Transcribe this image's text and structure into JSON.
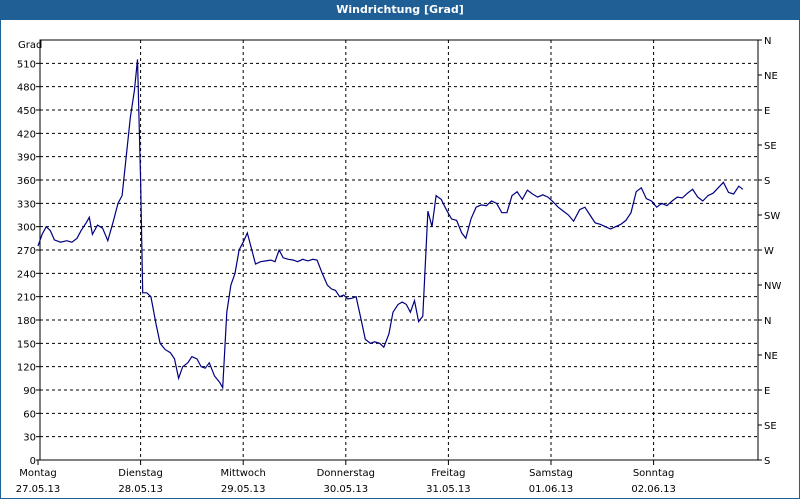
{
  "window": {
    "title": "Windrichtung [Grad]"
  },
  "chart_data": {
    "type": "line",
    "title": "Windrichtung [Grad]",
    "ylabel": "Grad",
    "ylim": [
      0,
      540
    ],
    "yticks": [
      0,
      30,
      60,
      90,
      120,
      150,
      180,
      210,
      240,
      270,
      300,
      330,
      360,
      390,
      420,
      450,
      480,
      510
    ],
    "y2_ticks": [
      "S",
      "SE",
      "E",
      "NE",
      "N",
      "NW",
      "W",
      "SW",
      "S",
      "SE",
      "E",
      "NE",
      "N"
    ],
    "grid": true,
    "x_labels": [
      {
        "day": "Montag",
        "date": "27.05.13"
      },
      {
        "day": "Dienstag",
        "date": "28.05.13"
      },
      {
        "day": "Mittwoch",
        "date": "29.05.13"
      },
      {
        "day": "Donnerstag",
        "date": "30.05.13"
      },
      {
        "day": "Freitag",
        "date": "31.05.13"
      },
      {
        "day": "Samstag",
        "date": "01.06.13"
      },
      {
        "day": "Sonntag",
        "date": "02.06.13"
      }
    ],
    "xlim_days": [
      0,
      7.0
    ],
    "series": [
      {
        "color": "#000080",
        "points": [
          [
            0.0,
            275
          ],
          [
            0.04,
            290
          ],
          [
            0.08,
            300
          ],
          [
            0.12,
            295
          ],
          [
            0.16,
            283
          ],
          [
            0.22,
            280
          ],
          [
            0.28,
            282
          ],
          [
            0.33,
            280
          ],
          [
            0.38,
            285
          ],
          [
            0.42,
            295
          ],
          [
            0.47,
            305
          ],
          [
            0.5,
            312
          ],
          [
            0.53,
            290
          ],
          [
            0.58,
            302
          ],
          [
            0.63,
            298
          ],
          [
            0.68,
            282
          ],
          [
            0.73,
            305
          ],
          [
            0.78,
            330
          ],
          [
            0.82,
            340
          ],
          [
            0.86,
            390
          ],
          [
            0.9,
            440
          ],
          [
            0.94,
            475
          ],
          [
            0.97,
            515
          ],
          [
            1.0,
            360
          ],
          [
            1.02,
            215
          ],
          [
            1.06,
            215
          ],
          [
            1.1,
            210
          ],
          [
            1.15,
            175
          ],
          [
            1.19,
            150
          ],
          [
            1.24,
            142
          ],
          [
            1.29,
            138
          ],
          [
            1.33,
            130
          ],
          [
            1.37,
            105
          ],
          [
            1.41,
            120
          ],
          [
            1.46,
            125
          ],
          [
            1.5,
            133
          ],
          [
            1.55,
            130
          ],
          [
            1.59,
            120
          ],
          [
            1.63,
            118
          ],
          [
            1.67,
            125
          ],
          [
            1.72,
            108
          ],
          [
            1.77,
            100
          ],
          [
            1.8,
            93
          ],
          [
            1.84,
            190
          ],
          [
            1.88,
            225
          ],
          [
            1.92,
            240
          ],
          [
            1.96,
            270
          ],
          [
            2.0,
            280
          ],
          [
            2.04,
            292
          ],
          [
            2.08,
            272
          ],
          [
            2.12,
            252
          ],
          [
            2.17,
            255
          ],
          [
            2.22,
            256
          ],
          [
            2.27,
            257
          ],
          [
            2.31,
            255
          ],
          [
            2.35,
            270
          ],
          [
            2.39,
            260
          ],
          [
            2.44,
            258
          ],
          [
            2.49,
            257
          ],
          [
            2.53,
            255
          ],
          [
            2.58,
            258
          ],
          [
            2.63,
            256
          ],
          [
            2.68,
            258
          ],
          [
            2.72,
            257
          ],
          [
            2.77,
            240
          ],
          [
            2.82,
            225
          ],
          [
            2.86,
            220
          ],
          [
            2.9,
            218
          ],
          [
            2.94,
            210
          ],
          [
            2.98,
            212
          ],
          [
            3.02,
            207
          ],
          [
            3.06,
            208
          ],
          [
            3.1,
            210
          ],
          [
            3.15,
            180
          ],
          [
            3.19,
            155
          ],
          [
            3.24,
            150
          ],
          [
            3.28,
            152
          ],
          [
            3.33,
            150
          ],
          [
            3.37,
            145
          ],
          [
            3.42,
            162
          ],
          [
            3.46,
            190
          ],
          [
            3.51,
            200
          ],
          [
            3.55,
            203
          ],
          [
            3.59,
            200
          ],
          [
            3.63,
            190
          ],
          [
            3.67,
            205
          ],
          [
            3.71,
            178
          ],
          [
            3.75,
            185
          ],
          [
            3.8,
            320
          ],
          [
            3.84,
            300
          ],
          [
            3.88,
            340
          ],
          [
            3.93,
            335
          ],
          [
            3.98,
            322
          ],
          [
            4.03,
            310
          ],
          [
            4.08,
            308
          ],
          [
            4.13,
            292
          ],
          [
            4.17,
            285
          ],
          [
            4.22,
            310
          ],
          [
            4.27,
            325
          ],
          [
            4.32,
            328
          ],
          [
            4.37,
            327
          ],
          [
            4.42,
            333
          ],
          [
            4.47,
            330
          ],
          [
            4.52,
            318
          ],
          [
            4.57,
            318
          ],
          [
            4.62,
            340
          ],
          [
            4.67,
            345
          ],
          [
            4.72,
            335
          ],
          [
            4.77,
            347
          ],
          [
            4.82,
            342
          ],
          [
            4.87,
            338
          ],
          [
            4.92,
            341
          ],
          [
            4.97,
            338
          ],
          [
            5.02,
            332
          ],
          [
            5.07,
            325
          ],
          [
            5.12,
            320
          ],
          [
            5.17,
            315
          ],
          [
            5.22,
            307
          ],
          [
            5.28,
            322
          ],
          [
            5.33,
            325
          ],
          [
            5.38,
            315
          ],
          [
            5.43,
            305
          ],
          [
            5.48,
            303
          ],
          [
            5.53,
            300
          ],
          [
            5.58,
            297
          ],
          [
            5.63,
            300
          ],
          [
            5.68,
            303
          ],
          [
            5.73,
            308
          ],
          [
            5.78,
            318
          ],
          [
            5.83,
            345
          ],
          [
            5.88,
            350
          ],
          [
            5.93,
            336
          ],
          [
            5.98,
            333
          ],
          [
            6.03,
            325
          ],
          [
            6.08,
            330
          ],
          [
            6.13,
            327
          ],
          [
            6.18,
            333
          ],
          [
            6.23,
            338
          ],
          [
            6.28,
            337
          ],
          [
            6.33,
            343
          ],
          [
            6.38,
            348
          ],
          [
            6.43,
            338
          ],
          [
            6.48,
            333
          ],
          [
            6.53,
            340
          ],
          [
            6.58,
            343
          ],
          [
            6.63,
            350
          ],
          [
            6.68,
            357
          ],
          [
            6.73,
            344
          ],
          [
            6.78,
            342
          ],
          [
            6.83,
            352
          ],
          [
            6.87,
            348
          ]
        ]
      }
    ]
  }
}
